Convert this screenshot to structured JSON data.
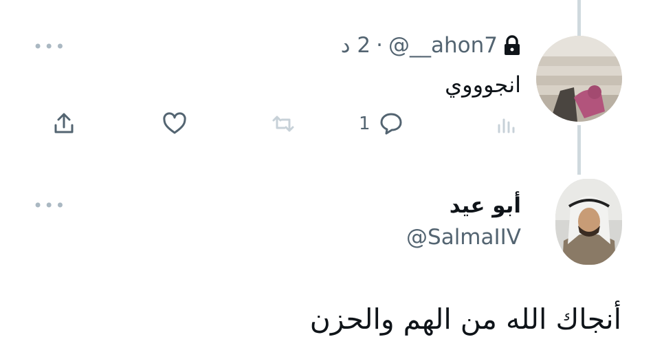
{
  "reply_tweet": {
    "handle": "@__ahon7",
    "separator": "·",
    "time": "2 د",
    "text": "انجوووي",
    "reply_count": "1",
    "more": "•••"
  },
  "original_tweet": {
    "author_name": "أبو عيد",
    "author_handle": "@SalmaIIV",
    "text": "أنجاك الله من الهم والحزن",
    "more": "•••"
  },
  "icons": {
    "lock": "lock-icon",
    "share": "share-icon",
    "like": "heart-icon",
    "retweet": "retweet-icon",
    "reply": "comment-icon",
    "views": "analytics-icon",
    "more": "more-dots-icon"
  },
  "colors": {
    "text_primary": "#0f1419",
    "text_secondary": "#536471",
    "thread_line": "#cfd9de",
    "icon_disabled": "#c7d1d8"
  }
}
